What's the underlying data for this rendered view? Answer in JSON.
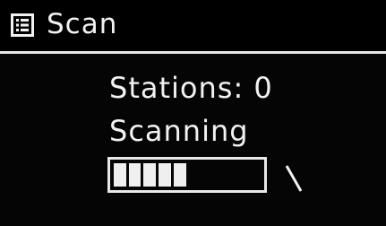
{
  "header": {
    "title": "Scan",
    "icon": "menu-list-icon"
  },
  "status": {
    "stations_label": "Stations: 0",
    "scanning_label": "Scanning"
  },
  "progress": {
    "fraction": 0.5,
    "segments_total": 10
  },
  "spinner": {
    "icon": "busy-spinner-icon"
  },
  "colors": {
    "background": "#050505",
    "foreground": "#f2f2f2"
  }
}
